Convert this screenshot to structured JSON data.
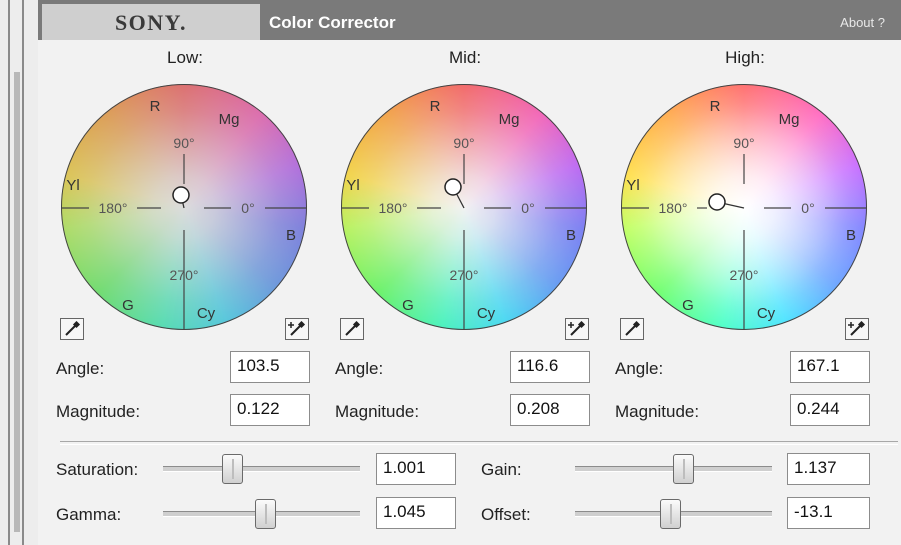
{
  "header": {
    "logo_text": "SONY.",
    "title": "Color Corrector",
    "about_label": "About  ?"
  },
  "wheel_markings": {
    "deg_90": "90°",
    "deg_180": "180°",
    "deg_0": "0°",
    "deg_270": "270°",
    "r": "R",
    "mg": "Mg",
    "yl": "Yl",
    "b": "B",
    "g": "G",
    "cy": "Cy"
  },
  "wheels": {
    "low": {
      "label": "Low:",
      "angle_label": "Angle:",
      "angle": "103.5",
      "magnitude_label": "Magnitude:",
      "magnitude": "0.122"
    },
    "mid": {
      "label": "Mid:",
      "angle_label": "Angle:",
      "angle": "116.6",
      "magnitude_label": "Magnitude:",
      "magnitude": "0.208"
    },
    "high": {
      "label": "High:",
      "angle_label": "Angle:",
      "angle": "167.1",
      "magnitude_label": "Magnitude:",
      "magnitude": "0.244"
    }
  },
  "controls": {
    "saturation": {
      "label": "Saturation:",
      "value": "1.001",
      "slider_fraction": 0.35
    },
    "gamma": {
      "label": "Gamma:",
      "value": "1.045",
      "slider_fraction": 0.52
    },
    "gain": {
      "label": "Gain:",
      "value": "1.137",
      "slider_fraction": 0.55
    },
    "offset": {
      "label": "Offset:",
      "value": "-13.1",
      "slider_fraction": 0.48
    }
  },
  "icons": {
    "eyedropper": "eyedropper-icon",
    "eyedropper_add": "eyedropper-plus-icon"
  },
  "colors": {
    "header_bg": "#7a7a7a",
    "panel_bg": "#f2f2f2"
  }
}
